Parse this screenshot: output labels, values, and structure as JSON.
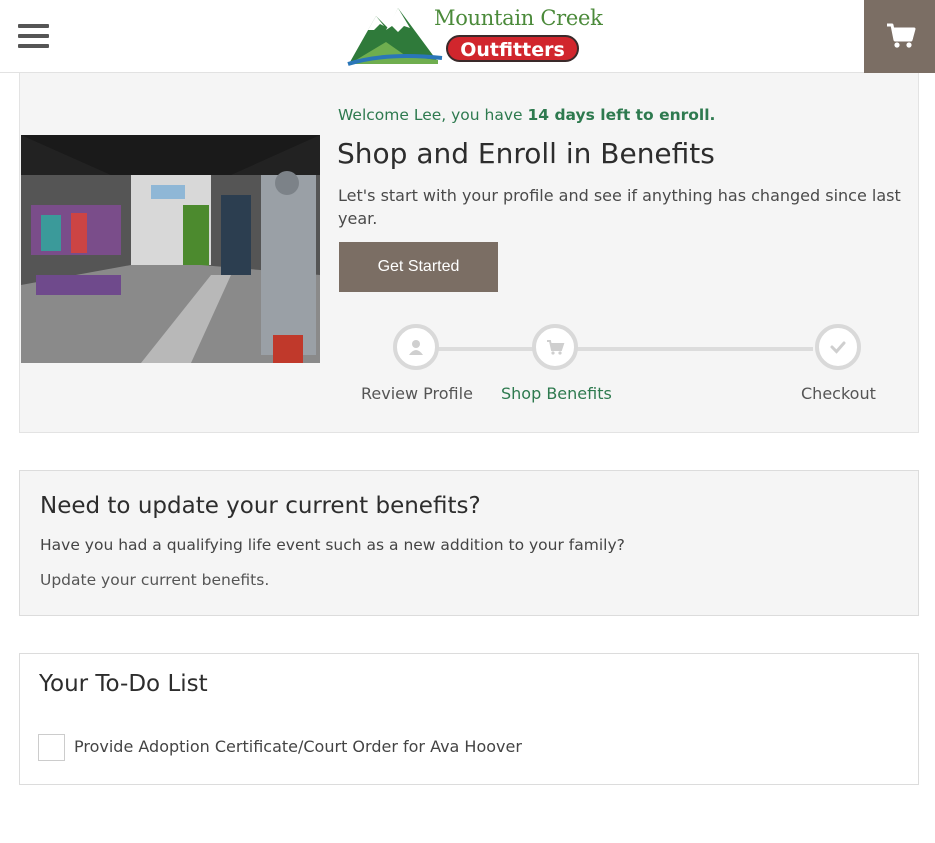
{
  "header": {
    "menu_icon": "hamburger-menu-icon",
    "logo": {
      "line1": "Mountain Creek",
      "line2": "Outfitters"
    },
    "cart_icon": "shopping-cart-icon"
  },
  "hero": {
    "image_alt": "Outdoor gear store interior with mannequin",
    "welcome_prefix": "Welcome Lee, you have ",
    "welcome_highlight": "14 days left to enroll.",
    "title": "Shop and Enroll in Benefits",
    "description": "Let's start with your profile and see if anything has changed since last year.",
    "cta_label": "Get Started",
    "steps": [
      {
        "label": "Review Profile",
        "icon": "person-icon",
        "active": false
      },
      {
        "label": "Shop Benefits",
        "icon": "cart-icon",
        "active": true
      },
      {
        "label": "Checkout",
        "icon": "checkmark-icon",
        "active": false
      }
    ]
  },
  "update_benefits": {
    "title": "Need to update your current benefits?",
    "description": "Have you had a qualifying life event such as a new addition to your family?",
    "link_label": "Update your current benefits."
  },
  "todo": {
    "title": "Your To-Do List",
    "items": [
      {
        "label": "Provide Adoption Certificate/Court Order for Ava Hoover",
        "checked": false
      }
    ]
  },
  "colors": {
    "accent_brown": "#7b6e64",
    "accent_green": "#2e7a4f",
    "logo_red": "#d1262d",
    "logo_green": "#4b8a3a"
  }
}
